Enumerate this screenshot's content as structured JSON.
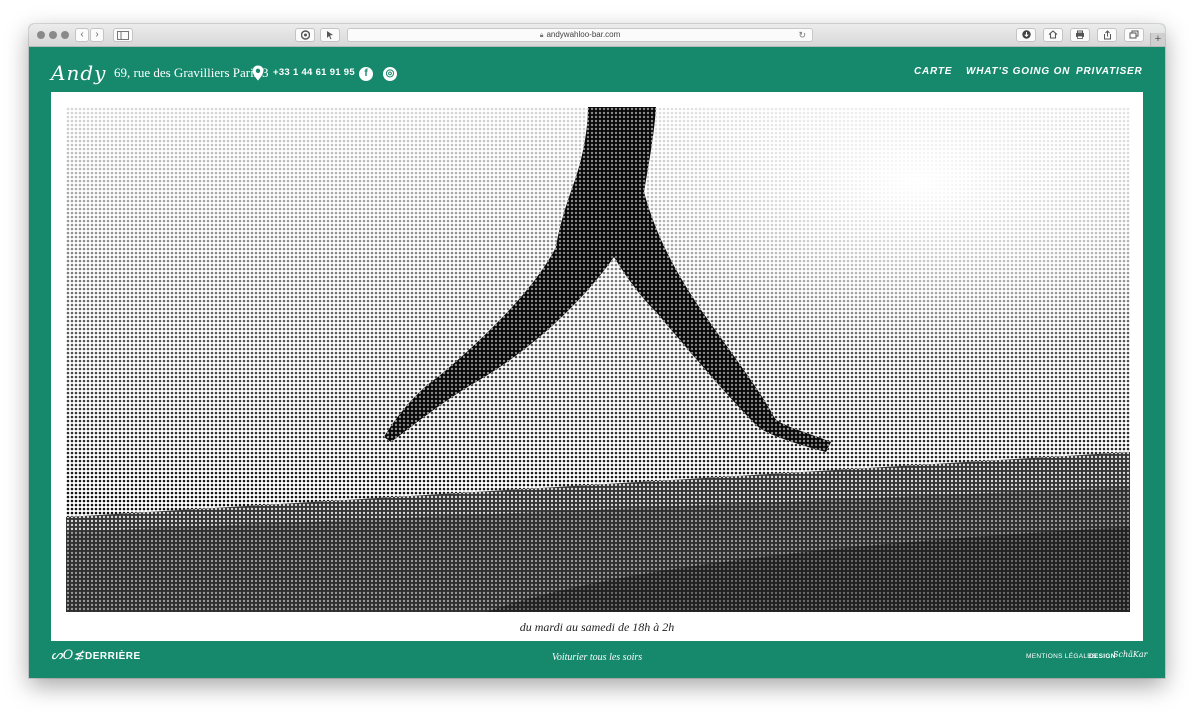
{
  "browser": {
    "url": "andywahloo-bar.com",
    "lock_icon": "lock-icon",
    "nav_back": "‹",
    "nav_forward": "›"
  },
  "header": {
    "logo": "Andy",
    "address": "69, rue des Gravilliers Paris 3",
    "phone": "+33 1 44 61 91 95",
    "social": {
      "facebook": "f",
      "instagram": "◎"
    },
    "nav": [
      "CARTE",
      "WHAT'S GOING ON",
      "PRIVATISER"
    ]
  },
  "hero": {
    "hours": "du mardi au samedi de 18h à 2h"
  },
  "footer": {
    "derriere_logo": "ᔕO≴",
    "derriere": "DERRIÈRE",
    "voiturier": "Voiturier tous les soirs",
    "mentions": "MENTIONS LÉGALES",
    "design": "DESIGN",
    "designer": "SchäKar"
  },
  "colors": {
    "brand_green": "#16896d",
    "frame": "#ffffff"
  }
}
